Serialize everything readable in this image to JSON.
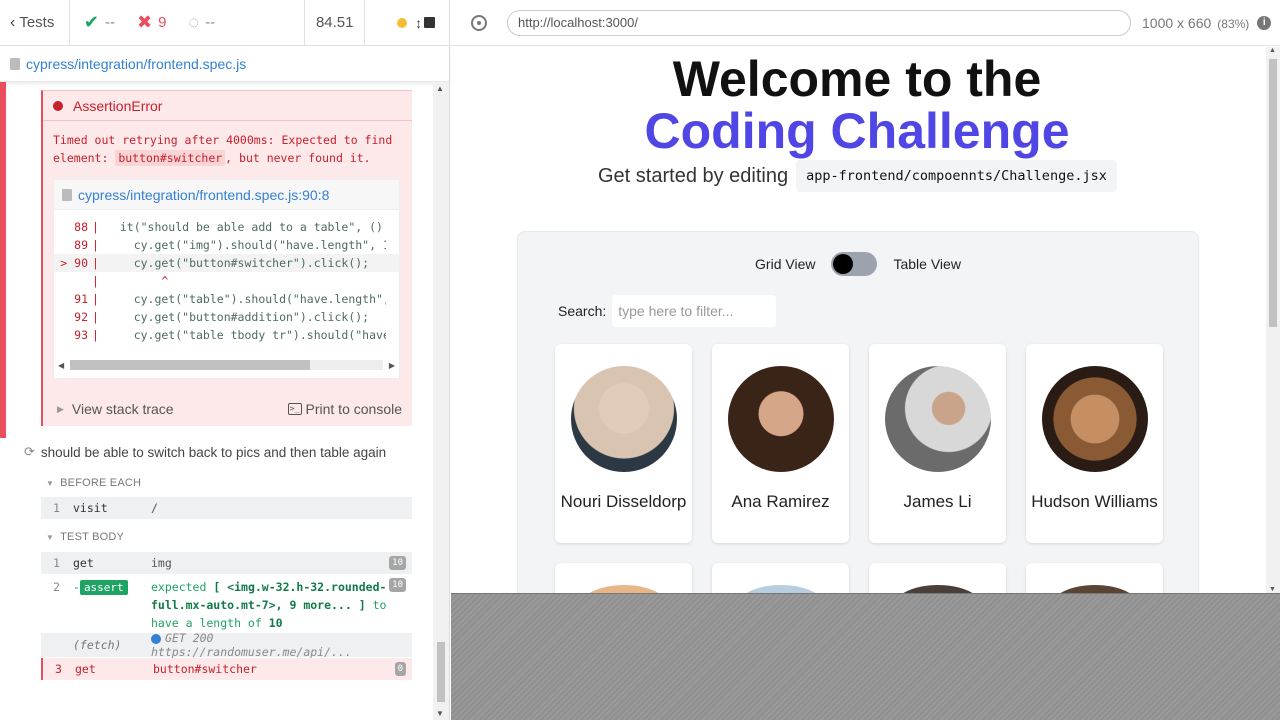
{
  "header": {
    "tests_label": "Tests",
    "passed": "--",
    "failed": "9",
    "pending": "--",
    "duration": "84.51"
  },
  "spec": {
    "path": "cypress/integration/frontend.spec.js"
  },
  "error": {
    "title": "AssertionError",
    "msg_line1": "Timed out retrying after 4000ms: Expected to find",
    "msg_pre": "element: ",
    "msg_code": "button#switcher",
    "msg_post": ", but never found it.",
    "frame_path": "cypress/integration/frontend.spec.js:90:8",
    "code": [
      {
        "n": "88",
        "t": "  it(\"should be able add to a table\", () =>"
      },
      {
        "n": "89",
        "t": "    cy.get(\"img\").should(\"have.length\", 10"
      },
      {
        "n": "90",
        "t": "    cy.get(\"button#switcher\").click();"
      },
      {
        "n": "",
        "t": "        ^"
      },
      {
        "n": "91",
        "t": "    cy.get(\"table\").should(\"have.length\","
      },
      {
        "n": "92",
        "t": "    cy.get(\"button#addition\").click();"
      },
      {
        "n": "93",
        "t": "    cy.get(\"table tbody tr\").should(\"have"
      }
    ],
    "view_stack": "View stack trace",
    "print_console": "Print to console"
  },
  "test2": {
    "title": "should be able to switch back to pics and then table again"
  },
  "hooks": {
    "before_each": "BEFORE EACH",
    "test_body": "TEST BODY"
  },
  "commands": {
    "visit": {
      "n": "1",
      "name": "visit",
      "msg": "/"
    },
    "get_img": {
      "n": "1",
      "name": "get",
      "msg": "img",
      "badge": "10"
    },
    "assert": {
      "n": "2",
      "prefix": "-",
      "name": "assert",
      "msg1": "expected",
      "msg2": "[ <img.w-32.h-32.rounded-",
      "msg3": "full.mx-auto.mt-7>, 9 more... ]",
      "msg4": "to",
      "msg5": "have a length of",
      "msg6": "10",
      "badge": "10"
    },
    "fetch": {
      "name": "(fetch)",
      "msg": "GET 200 https://randomuser.me/api/..."
    },
    "get_switcher": {
      "n": "3",
      "name": "get",
      "msg": "button#switcher",
      "badge": "0"
    }
  },
  "aut": {
    "url": "http://localhost:3000/",
    "size": "1000 x 660",
    "pct": "(83%)"
  },
  "app": {
    "welcome": "Welcome to the",
    "coding": "Coding Challenge",
    "started": "Get started by editing",
    "path": "app-frontend/compoennts/Challenge.jsx",
    "grid_view": "Grid View",
    "table_view": "Table View",
    "search_label": "Search:",
    "search_placeholder": "type here to filter...",
    "people": [
      {
        "name": "Nouri Disseldorp",
        "color": "#c9b7a7"
      },
      {
        "name": "Ana Ramirez",
        "color": "#5b3a2a"
      },
      {
        "name": "James Li",
        "color": "#cfcfcf"
      },
      {
        "name": "Hudson Williams",
        "color": "#3a2a20"
      }
    ]
  }
}
